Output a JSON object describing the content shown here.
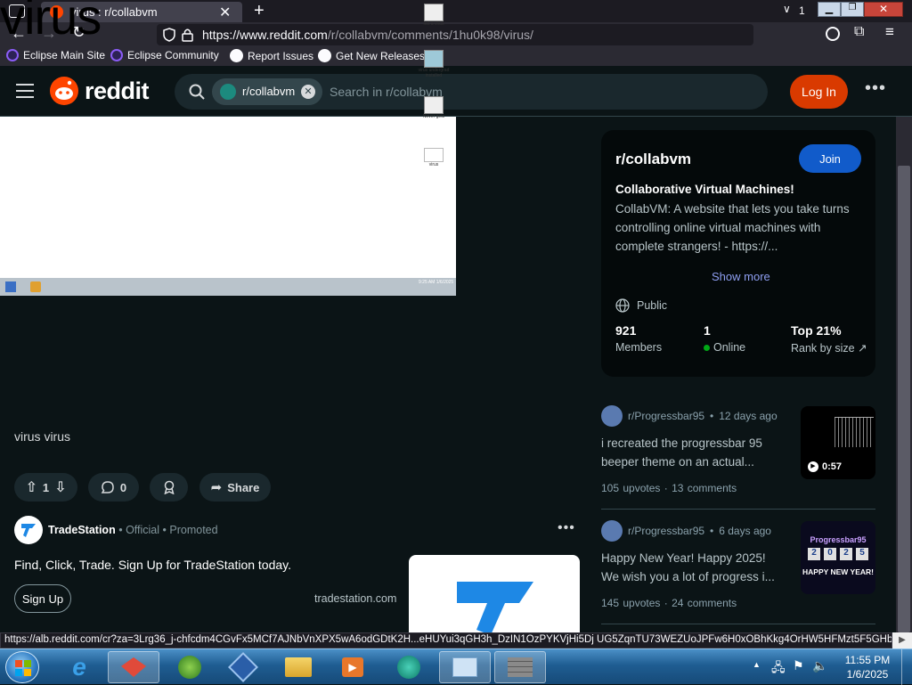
{
  "browser": {
    "tab_title": "virus : r/collabvm",
    "tab_count": "1",
    "url_host": "https://www.reddit.com",
    "url_path": "/r/collabvm/comments/1hu0k98/virus/",
    "bookmarks": [
      {
        "label": "Eclipse Main Site",
        "icon": "eclipse-icon"
      },
      {
        "label": "Eclipse Community",
        "icon": "eclipse-icon"
      },
      {
        "label": "Report Issues",
        "icon": "github-icon"
      },
      {
        "label": "Get New Releases",
        "icon": "github-icon"
      }
    ],
    "status_url": "https://alb.reddit.com/cr?za=3Lrg36_j-chfcdm4CGvFx5MCf7AJNbVnXPX5wA6odGDtK2H...eHUYui3qGH3h_DzIN1OzPYKVjHi5Dj UG5ZqnTU73WEZUoJPFw6H0xOBhKkg4OrHW5HFMzt5F5GHb"
  },
  "header": {
    "logo_text": "reddit",
    "chip_label": "r/collabvm",
    "search_placeholder": "Search in r/collabvm",
    "login_label": "Log In",
    "brand_color": "#ff4500"
  },
  "post": {
    "image": {
      "big_text": "virus",
      "desktop_icons": [
        "not a virus",
        "virus undergrad installed",
        "Never gets",
        "virus"
      ],
      "clock": "9:25 AM 1/6/2025"
    },
    "body": "virus virus",
    "score": "1",
    "comments": "0",
    "share_label": "Share"
  },
  "ad": {
    "brand": "TradeStation",
    "official": "Official",
    "promoted": "Promoted",
    "text": "Find, Click, Trade. Sign Up for TradeStation today.",
    "cta": "Sign Up",
    "domain": "tradestation.com"
  },
  "sidebar": {
    "name": "r/collabvm",
    "join_label": "Join",
    "tagline": "Collaborative Virtual Machines!",
    "description": "CollabVM: A website that lets you take turns controlling online virtual machines with complete strangers! - https://...",
    "show_more": "Show more",
    "visibility": "Public",
    "stats": [
      {
        "value": "921",
        "label": "Members"
      },
      {
        "value": "1",
        "label": "Online"
      },
      {
        "value": "Top 21%",
        "label": "Rank by size"
      }
    ]
  },
  "related": [
    {
      "author": "r/Progressbar95",
      "age": "12 days ago",
      "title_line1": "i recreated the progressbar 95",
      "title_line2": "beeper theme on an actual...",
      "upvotes": "105 upvotes",
      "comments": "13 comments",
      "thumb_badge": "0:57"
    },
    {
      "author": "r/Progressbar95",
      "age": "6 days ago",
      "title_line1": "Happy New Year! Happy 2025!",
      "title_line2": "We wish you a lot of progress i...",
      "upvotes": "145 upvotes",
      "comments": "24 comments",
      "thumb_top": "Progressbar95",
      "thumb_digits": [
        "2",
        "0",
        "2",
        "5"
      ],
      "thumb_bottom": "HAPPY NEW YEAR!"
    }
  ],
  "taskbar": {
    "time": "11:55 PM",
    "date": "1/6/2025"
  }
}
